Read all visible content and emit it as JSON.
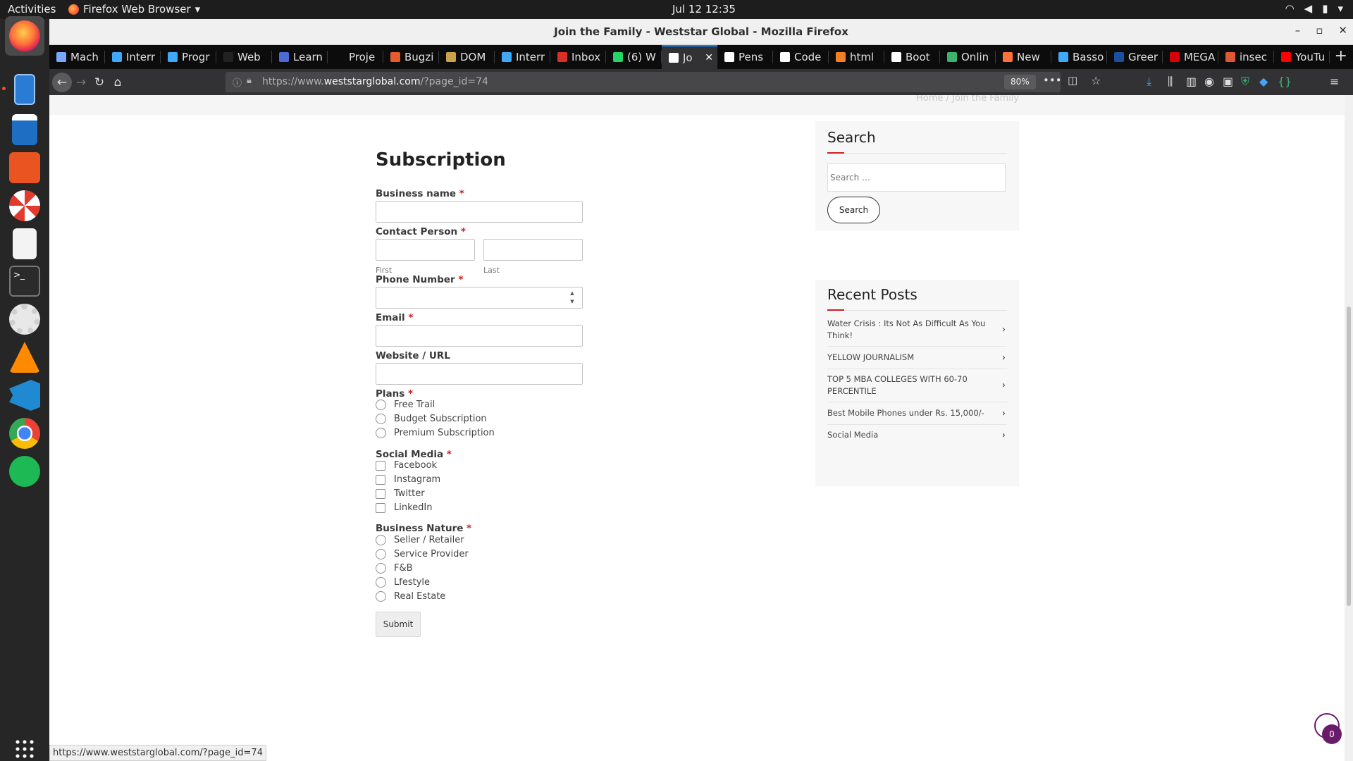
{
  "topbar": {
    "activities": "Activities",
    "app_name": "Firefox Web Browser",
    "clock": "Jul 12  12:35"
  },
  "window": {
    "title": "Join the Family - Weststar Global - Mozilla Firefox"
  },
  "tabs": [
    {
      "label": "Mach",
      "icon": "link-icon",
      "color": "#7aa7ff"
    },
    {
      "label": "Interr",
      "icon": "is-icon",
      "color": "#3fa9f5"
    },
    {
      "label": "Progr",
      "icon": "is-icon",
      "color": "#3fa9f5"
    },
    {
      "label": "Web",
      "icon": "github-icon",
      "color": "#222222"
    },
    {
      "label": "Learn",
      "icon": "compass-icon",
      "color": "#4b6bd6"
    },
    {
      "label": "Proje",
      "icon": "blank-icon",
      "color": "#0c0c0d"
    },
    {
      "label": "Bugzi",
      "icon": "bugzilla-icon",
      "color": "#e55b2c"
    },
    {
      "label": "DOM",
      "icon": "owl-icon",
      "color": "#c9a24b"
    },
    {
      "label": "Interr",
      "icon": "is-icon",
      "color": "#3fa9f5"
    },
    {
      "label": "Inbox",
      "icon": "gmail-icon",
      "color": "#d93025"
    },
    {
      "label": "(6) W",
      "icon": "whatsapp-icon",
      "color": "#25d366"
    },
    {
      "label": "Jo",
      "icon": "page-icon",
      "color": "#ffffff",
      "active": true
    },
    {
      "label": "Pens",
      "icon": "codepen-icon",
      "color": "#ffffff"
    },
    {
      "label": "Code",
      "icon": "codepen-icon",
      "color": "#ffffff"
    },
    {
      "label": "html",
      "icon": "stackoverflow-icon",
      "color": "#f48024"
    },
    {
      "label": "Boot",
      "icon": "medium-icon",
      "color": "#ffffff"
    },
    {
      "label": "Onlin",
      "icon": "code-icon",
      "color": "#3cb371"
    },
    {
      "label": "New",
      "icon": "firefox-icon",
      "color": "#ff7139"
    },
    {
      "label": "Basso",
      "icon": "wave-icon",
      "color": "#3fa9f5"
    },
    {
      "label": "Greer",
      "icon": "paytm-icon",
      "color": "#1b4fa0"
    },
    {
      "label": "MEGA",
      "icon": "mega-icon",
      "color": "#d90007"
    },
    {
      "label": "insec",
      "icon": "duckduckgo-icon",
      "color": "#de5833"
    },
    {
      "label": "YouTu",
      "icon": "youtube-icon",
      "color": "#ff0000"
    }
  ],
  "urlbar": {
    "url_prefix": "https://www.",
    "url_domain": "weststarglobal.com",
    "url_path": "/?page_id=74",
    "zoom": "80%"
  },
  "page": {
    "breadcrumb": "Home  /  Join the Family",
    "form": {
      "title": "Subscription",
      "business_name": "Business name",
      "contact_person": "Contact Person",
      "first": "First",
      "last": "Last",
      "phone": "Phone Number",
      "email": "Email",
      "website": "Website / URL",
      "plans_label": "Plans",
      "plans": [
        "Free Trail",
        "Budget Subscription",
        "Premium Subscription"
      ],
      "social_label": "Social Media",
      "social": [
        "Facebook",
        "Instagram",
        "Twitter",
        "LinkedIn"
      ],
      "nature_label": "Business Nature",
      "nature": [
        "Seller / Retailer",
        "Service Provider",
        "F&B",
        "Lfestyle",
        "Real Estate"
      ],
      "required_mark": "*",
      "submit": "Submit"
    },
    "search_widget": {
      "title": "Search",
      "placeholder": "Search …",
      "button": "Search"
    },
    "recent_posts": {
      "title": "Recent Posts",
      "items": [
        "Water Crisis : Its Not As Difficult As You Think!",
        "YELLOW JOURNALISM",
        "TOP 5 MBA COLLEGES WITH 60-70 PERCENTILE",
        "Best Mobile Phones under Rs. 15,000/-",
        "Social Media"
      ]
    },
    "floating_badge": "0"
  },
  "status_url": "https://www.weststarglobal.com/?page_id=74"
}
